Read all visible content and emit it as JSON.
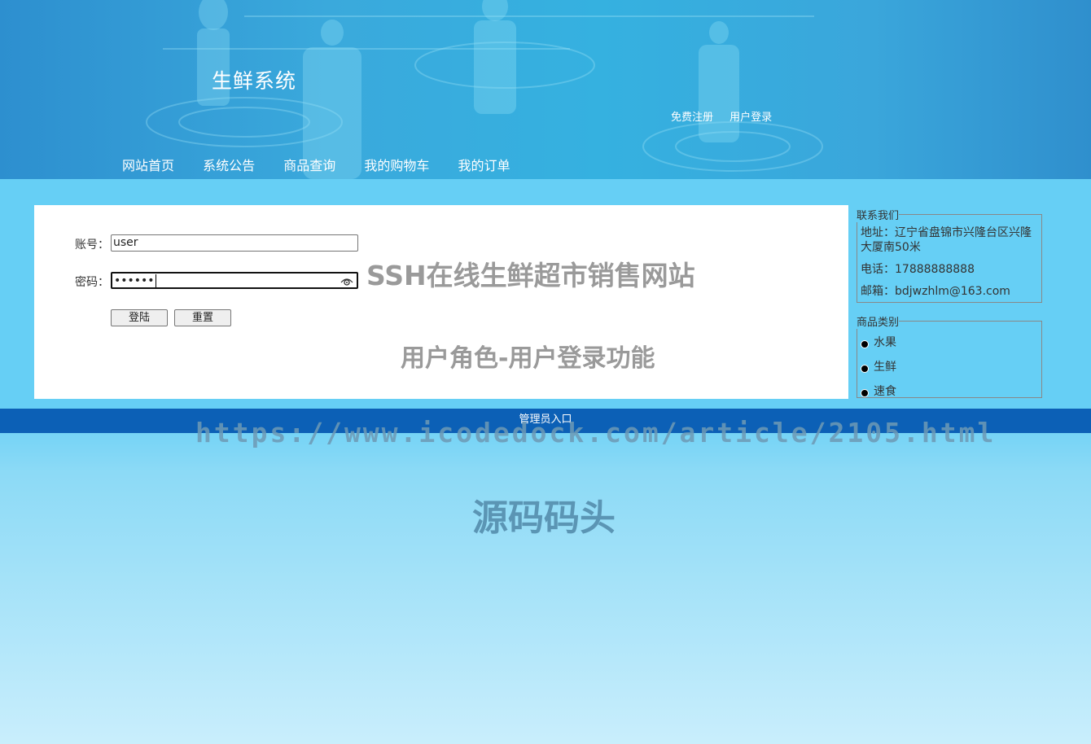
{
  "header": {
    "site_title": "生鲜系统",
    "register_link": "免费注册",
    "login_link": "用户登录"
  },
  "nav": {
    "items": [
      {
        "label": "网站首页"
      },
      {
        "label": "系统公告"
      },
      {
        "label": "商品查询"
      },
      {
        "label": "我的购物车"
      },
      {
        "label": "我的订单"
      }
    ]
  },
  "login_form": {
    "account_label": "账号：",
    "account_value": "user",
    "password_label": "密码：",
    "password_value": "••••••",
    "login_button": "登陆",
    "reset_button": "重置"
  },
  "watermarks": {
    "title": "SSH在线生鲜超市销售网站",
    "subtitle": "用户角色-用户登录功能",
    "url": "https://www.icodedock.com/article/2105.html",
    "brand": "源码码头"
  },
  "contact": {
    "legend": "联系我们",
    "address": "地址：辽宁省盘锦市兴隆台区兴隆大厦南50米",
    "phone": "电话：17888888888",
    "email": "邮箱：bdjwzhlm@163.com"
  },
  "categories": {
    "legend": "商品类别",
    "items": [
      {
        "label": "水果"
      },
      {
        "label": "生鲜"
      },
      {
        "label": "速食"
      }
    ]
  },
  "footer": {
    "admin_link": "管理员入口"
  },
  "colors": {
    "header_blue": "#3aa9dc",
    "page_bg": "#66cff5",
    "footer_bar": "#0c60b6"
  }
}
